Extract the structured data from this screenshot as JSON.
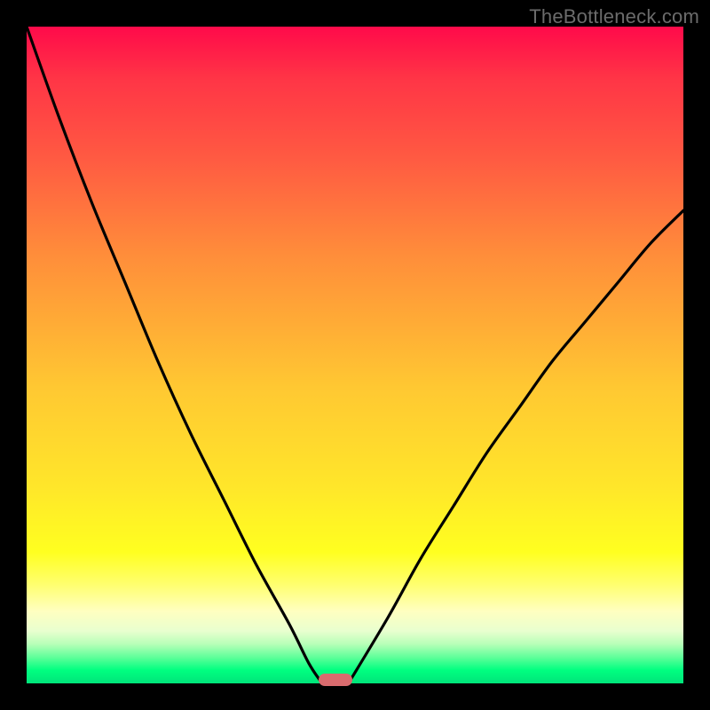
{
  "watermark": "TheBottleneck.com",
  "chart_data": {
    "type": "line",
    "title": "",
    "xlabel": "",
    "ylabel": "",
    "xlim": [
      0,
      1
    ],
    "ylim": [
      0,
      1
    ],
    "series": [
      {
        "name": "left-curve",
        "x": [
          0.0,
          0.05,
          0.1,
          0.15,
          0.2,
          0.25,
          0.3,
          0.35,
          0.4,
          0.43,
          0.45
        ],
        "values": [
          1.0,
          0.86,
          0.73,
          0.61,
          0.49,
          0.38,
          0.28,
          0.18,
          0.09,
          0.03,
          0.0
        ]
      },
      {
        "name": "right-curve",
        "x": [
          0.49,
          0.55,
          0.6,
          0.65,
          0.7,
          0.75,
          0.8,
          0.85,
          0.9,
          0.95,
          1.0
        ],
        "values": [
          0.0,
          0.1,
          0.19,
          0.27,
          0.35,
          0.42,
          0.49,
          0.55,
          0.61,
          0.67,
          0.72
        ]
      }
    ],
    "marker": {
      "x": 0.47,
      "y": 0.005
    },
    "background_gradient": {
      "top": "#ff0a4a",
      "mid": "#ffe62a",
      "bottom": "#00e47a"
    }
  },
  "frame": {
    "border_px": 30,
    "border_color": "#000000",
    "inner_size_px": 740
  }
}
